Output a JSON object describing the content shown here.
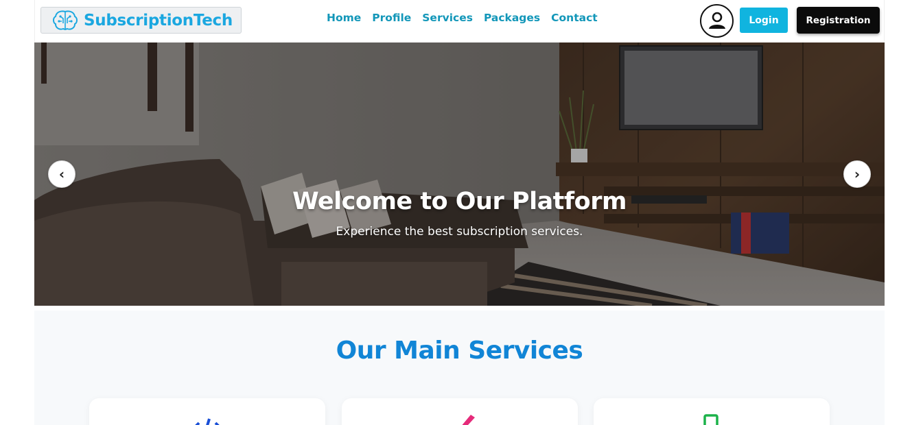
{
  "brand": {
    "name": "SubscriptionTech",
    "icon": "brain-circuit-icon",
    "accent": "#1aa7e0"
  },
  "nav": {
    "links": [
      {
        "label": "Home"
      },
      {
        "label": "Profile"
      },
      {
        "label": "Services"
      },
      {
        "label": "Packages"
      },
      {
        "label": "Contact"
      }
    ],
    "link_color": "#1397b9"
  },
  "header_actions": {
    "avatar_icon": "user-circle-icon",
    "login_label": "Login",
    "register_label": "Registration",
    "login_color": "#10b4df",
    "register_color": "#0b0b0b"
  },
  "hero": {
    "title": "Welcome to Our Platform",
    "subtitle": "Experience the best subscription services.",
    "prev_icon": "chevron-left-icon",
    "prev_glyph": "‹",
    "next_icon": "chevron-right-icon",
    "next_glyph": "›"
  },
  "services": {
    "title": "Our Main Services",
    "title_color": "#1185d6",
    "cards": [
      {
        "icon": "code-icon",
        "icon_color": "#1a4fd6"
      },
      {
        "icon": "brush-icon",
        "icon_color": "#e52b7a"
      },
      {
        "icon": "mobile-icon",
        "icon_color": "#1cb24a"
      }
    ]
  }
}
